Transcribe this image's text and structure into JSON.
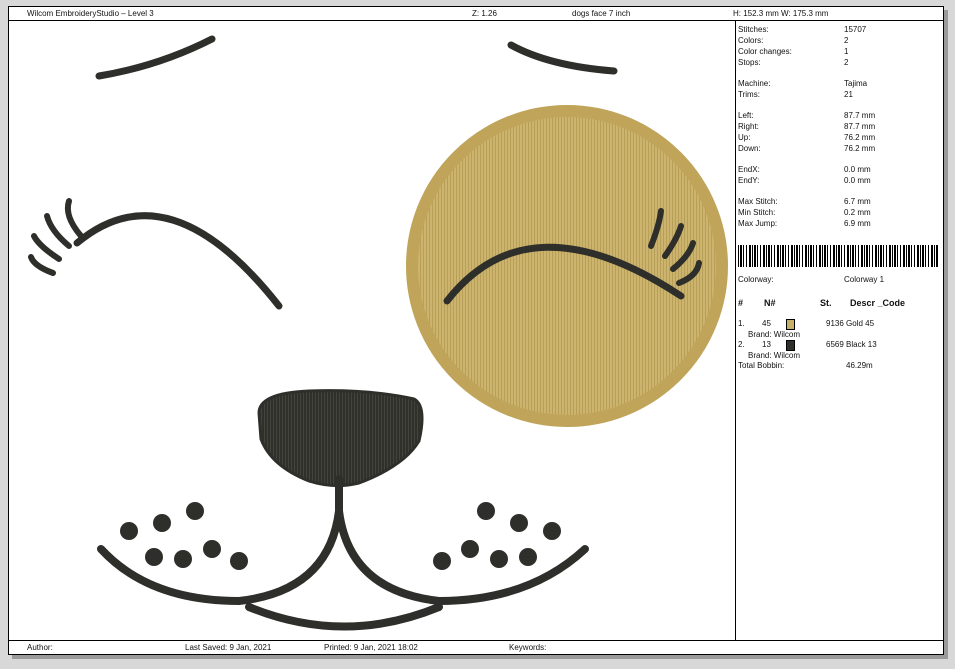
{
  "header": {
    "app_title": "Wilcom EmbroideryStudio – Level 3",
    "zoom": "Z: 1.26",
    "design_name": "dogs face 7 inch",
    "dimensions": "H: 152.3 mm   W: 175.3 mm"
  },
  "stats": [
    {
      "label": "Stitches:",
      "value": "15707"
    },
    {
      "label": "Colors:",
      "value": "2"
    },
    {
      "label": "Color changes:",
      "value": "1"
    },
    {
      "label": "Stops:",
      "value": "2"
    },
    {
      "label": "Machine:",
      "value": "Tajima"
    },
    {
      "label": "Trims:",
      "value": "21"
    },
    {
      "label": "Left:",
      "value": "87.7 mm"
    },
    {
      "label": "Right:",
      "value": "87.7 mm"
    },
    {
      "label": "Up:",
      "value": "76.2 mm"
    },
    {
      "label": "Down:",
      "value": "76.2 mm"
    },
    {
      "label": "EndX:",
      "value": "0.0 mm"
    },
    {
      "label": "EndY:",
      "value": "0.0 mm"
    },
    {
      "label": "Max Stitch:",
      "value": "6.7 mm"
    },
    {
      "label": "Min Stitch:",
      "value": "0.2 mm"
    },
    {
      "label": "Max Jump:",
      "value": "6.9 mm"
    }
  ],
  "colorway": {
    "label": "Colorway:",
    "value": "Colorway 1"
  },
  "table": {
    "headers": [
      "#",
      "N#",
      "St.",
      "Descr _Code"
    ],
    "rows": [
      {
        "index": "1.",
        "number": "45",
        "stitches": "9136",
        "descr": "Gold 45",
        "brand": "Brand: Wilcom",
        "swatch": "#c9b06a"
      },
      {
        "index": "2.",
        "number": "13",
        "stitches": "6569",
        "descr": "Black 13",
        "brand": "Brand: Wilcom",
        "swatch": "#2e2e2a"
      }
    ],
    "total_label": "Total Bobbin:",
    "total_value": "46.29m"
  },
  "footer": {
    "author": "Author:",
    "last_saved": "Last Saved:  9 Jan, 2021",
    "printed": "Printed:   9 Jan, 2021 18:02",
    "keywords": "Keywords:"
  },
  "colors": {
    "gold": "#c9b06a",
    "black": "#2e2e2a"
  }
}
